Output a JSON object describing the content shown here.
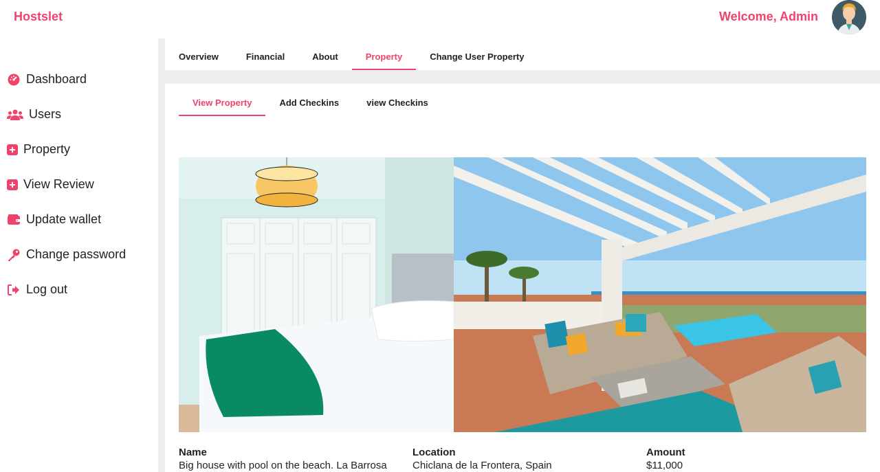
{
  "header": {
    "brand": "Hostslet",
    "welcome": "Welcome, Admin"
  },
  "sidebar": {
    "items": [
      {
        "label": "Dashboard",
        "icon": "dashboard-icon"
      },
      {
        "label": "Users",
        "icon": "users-icon"
      },
      {
        "label": "Property",
        "icon": "plus-square-icon"
      },
      {
        "label": "View Review",
        "icon": "plus-square-icon"
      },
      {
        "label": "Update wallet",
        "icon": "wallet-icon"
      },
      {
        "label": "Change password",
        "icon": "key-icon"
      },
      {
        "label": "Log out",
        "icon": "logout-icon"
      }
    ]
  },
  "tabs": {
    "items": [
      "Overview",
      "Financial",
      "About",
      "Property",
      "Change User Property"
    ],
    "active": "Property"
  },
  "subtabs": {
    "items": [
      "View Property",
      "Add Checkins",
      "view Checkins"
    ],
    "active": "View Property"
  },
  "property": {
    "name_label": "Name",
    "name_value": "Big house with pool on the beach. La Barrosa",
    "location_label": "Location",
    "location_value": "Chiclana de la Frontera, Spain",
    "amount_label": "Amount",
    "amount_value": "$11,000"
  },
  "colors": {
    "accent": "#f0436c",
    "divider": "#eeeeee"
  }
}
